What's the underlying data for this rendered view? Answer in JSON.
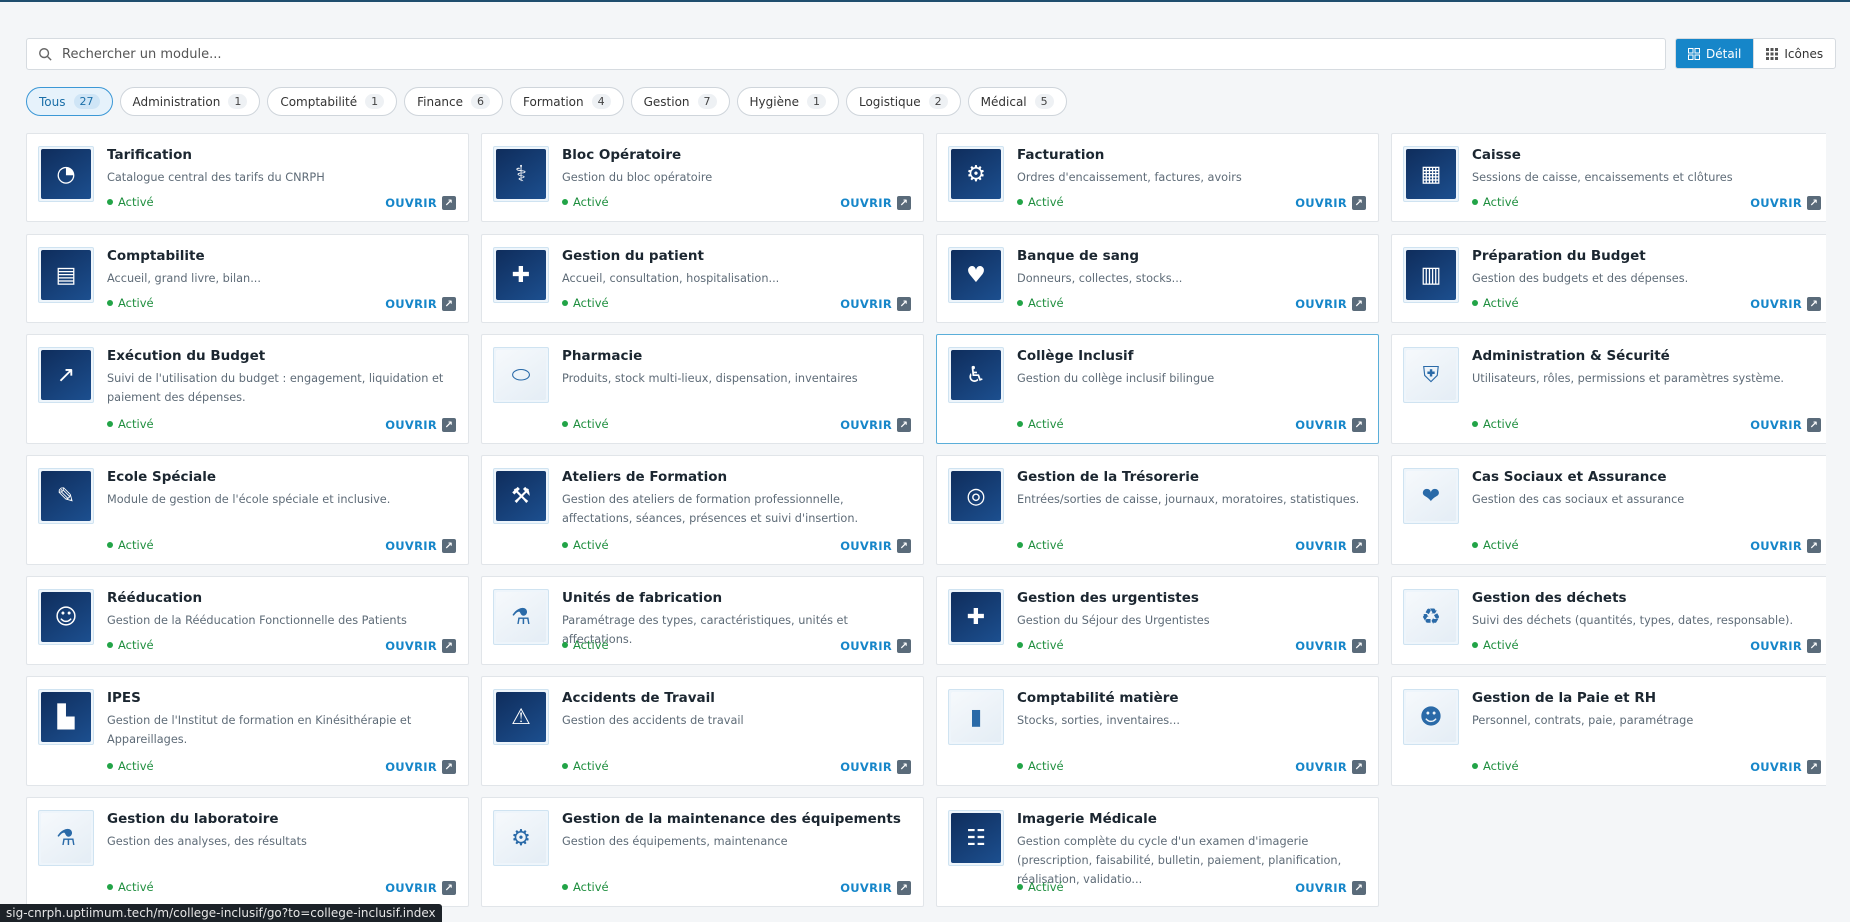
{
  "search": {
    "placeholder": "Rechercher un module..."
  },
  "view_toggle": {
    "detail_label": "Détail",
    "icons_label": "Icônes"
  },
  "filters": [
    {
      "label": "Tous",
      "count": "27"
    },
    {
      "label": "Administration",
      "count": "1"
    },
    {
      "label": "Comptabilité",
      "count": "1"
    },
    {
      "label": "Finance",
      "count": "6"
    },
    {
      "label": "Formation",
      "count": "4"
    },
    {
      "label": "Gestion",
      "count": "7"
    },
    {
      "label": "Hygiène",
      "count": "1"
    },
    {
      "label": "Logistique",
      "count": "2"
    },
    {
      "label": "Médical",
      "count": "5"
    }
  ],
  "card_common": {
    "status": "Activé",
    "open_label": "OUVRIR"
  },
  "modules": [
    {
      "title": "Tarification",
      "desc": "Catalogue central des tarifs du CNRPH",
      "icon": "pie-chart-icon",
      "glyph": "◔"
    },
    {
      "title": "Bloc Opératoire",
      "desc": "Gestion du bloc opératoire",
      "icon": "operating-table-icon",
      "glyph": "⚕"
    },
    {
      "title": "Facturation",
      "desc": "Ordres d'encaissement, factures, avoirs",
      "icon": "invoice-gear-icon",
      "glyph": "⚙"
    },
    {
      "title": "Caisse",
      "desc": "Sessions de caisse, encaissements et clôtures",
      "icon": "cash-register-icon",
      "glyph": "▦"
    },
    {
      "title": "Comptabilite",
      "desc": "Accueil, grand livre, bilan...",
      "icon": "ledger-icon",
      "glyph": "▤"
    },
    {
      "title": "Gestion du patient",
      "desc": "Accueil, consultation, hospitalisation...",
      "icon": "patient-icon",
      "glyph": "✚"
    },
    {
      "title": "Banque de sang",
      "desc": "Donneurs, collectes, stocks...",
      "icon": "blood-bag-icon",
      "glyph": "♥"
    },
    {
      "title": "Préparation du Budget",
      "desc": "Gestion des budgets et des dépenses.",
      "icon": "budget-document-icon",
      "glyph": "▥"
    },
    {
      "title": "Exécution du Budget",
      "desc": "Suivi de l'utilisation du budget : engagement, liquidation et paiement des dépenses.",
      "icon": "budget-chart-icon",
      "glyph": "↗"
    },
    {
      "title": "Pharmacie",
      "desc": "Produits, stock multi-lieux, dispensation, inventaires",
      "icon": "pill-icon",
      "glyph": "⬭"
    },
    {
      "title": "Collège Inclusif",
      "desc": "Gestion du collège inclusif bilingue",
      "icon": "wheelchair-icon",
      "glyph": "♿"
    },
    {
      "title": "Administration & Sécurité",
      "desc": "Utilisateurs, rôles, permissions et paramètres système.",
      "icon": "shield-lock-icon",
      "glyph": "⛨"
    },
    {
      "title": "Ecole Spéciale",
      "desc": "Module de gestion de l'école spéciale et inclusive.",
      "icon": "teacher-board-icon",
      "glyph": "✎"
    },
    {
      "title": "Ateliers de Formation",
      "desc": "Gestion des ateliers de formation professionnelle, affectations, séances, présences et suivi d'insertion.",
      "icon": "tools-icon",
      "glyph": "⚒"
    },
    {
      "title": "Gestion de la Trésorerie",
      "desc": "Entrées/sorties de caisse, journaux, moratoires, statistiques.",
      "icon": "coins-icon",
      "glyph": "◎"
    },
    {
      "title": "Cas Sociaux et Assurance",
      "desc": "Gestion des cas sociaux et assurance",
      "icon": "heart-hands-icon",
      "glyph": "❤"
    },
    {
      "title": "Rééducation",
      "desc": "Gestion de la Rééducation Fonctionnelle des Patients",
      "icon": "rehab-people-icon",
      "glyph": "☺"
    },
    {
      "title": "Unités de fabrication",
      "desc": "Paramétrage des types, caractéristiques, unités et affectations.",
      "icon": "microscope-icon",
      "glyph": "⚗"
    },
    {
      "title": "Gestion des urgentistes",
      "desc": "Gestion du Séjour des Urgentistes",
      "icon": "ambulance-icon",
      "glyph": "✚"
    },
    {
      "title": "Gestion des déchets",
      "desc": "Suivi des déchets (quantités, types, dates, responsable).",
      "icon": "recycle-bin-icon",
      "glyph": "♻"
    },
    {
      "title": "IPES",
      "desc": "Gestion de l'Institut de formation en Kinésithérapie et Appareillages.",
      "icon": "graduation-books-icon",
      "glyph": "▙"
    },
    {
      "title": "Accidents de Travail",
      "desc": "Gestion des accidents de travail",
      "icon": "worker-warning-icon",
      "glyph": "⚠"
    },
    {
      "title": "Comptabilité matière",
      "desc": "Stocks, sorties, inventaires...",
      "icon": "inventory-chart-icon",
      "glyph": "▮"
    },
    {
      "title": "Gestion de la Paie et RH",
      "desc": "Personnel, contrats, paie, paramétrage",
      "icon": "staff-icon",
      "glyph": "☻"
    },
    {
      "title": "Gestion du laboratoire",
      "desc": "Gestion des analyses, des résultats",
      "icon": "test-tubes-icon",
      "glyph": "⚗"
    },
    {
      "title": "Gestion de la maintenance des équipements",
      "desc": "Gestion des équipements, maintenance",
      "icon": "maintenance-monitor-icon",
      "glyph": "⚙"
    },
    {
      "title": "Imagerie Médicale",
      "desc": "Gestion complète du cycle d'un examen d'imagerie (prescription, faisabilité, bulletin, paiement, planification, réalisation, validatio...",
      "icon": "xray-lungs-icon",
      "glyph": "☷"
    }
  ],
  "status_bar": {
    "url": "sig-cnrph.uptiimum.tech/m/college-inclusif/go?to=college-inclusif.index"
  }
}
